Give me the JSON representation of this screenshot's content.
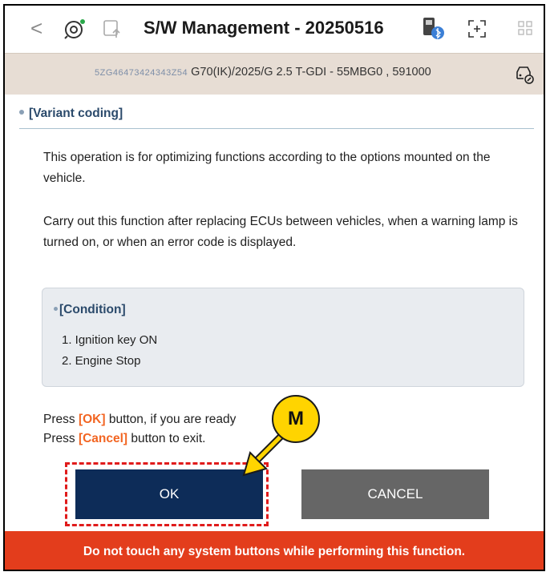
{
  "topbar": {
    "back_icon": "chevron-left-icon",
    "title": "S/W Management - 20250516"
  },
  "vehicle": {
    "vin": "5ZG46473424343Z54",
    "description": "G70(IK)/2025/G 2.5 T-GDI  - 55MBG0 , 591000"
  },
  "section": {
    "title": "[Variant coding]"
  },
  "content": {
    "para1": "This operation is for optimizing functions according to the options mounted on the vehicle.",
    "para2": "Carry out this function after replacing ECUs between vehicles, when a warning lamp is turned on, or when an error code is displayed."
  },
  "condition": {
    "title": "[Condition]",
    "items": [
      "1. Ignition key ON",
      "2. Engine Stop"
    ]
  },
  "instructions": {
    "line1_pre": "Press ",
    "line1_hl": "[OK]",
    "line1_post": " button, if you are ready",
    "line2_pre": "Press ",
    "line2_hl": "[Cancel]",
    "line2_post": " button to exit."
  },
  "buttons": {
    "ok": "OK",
    "cancel": "CANCEL"
  },
  "warning": "Do not touch any system buttons while performing this function.",
  "marker": "M",
  "colors": {
    "ok_button": "#0d2c58",
    "cancel_button": "#666666",
    "warning_bar": "#e33d1c",
    "highlight": "#f26522",
    "marker": "#ffd400"
  }
}
